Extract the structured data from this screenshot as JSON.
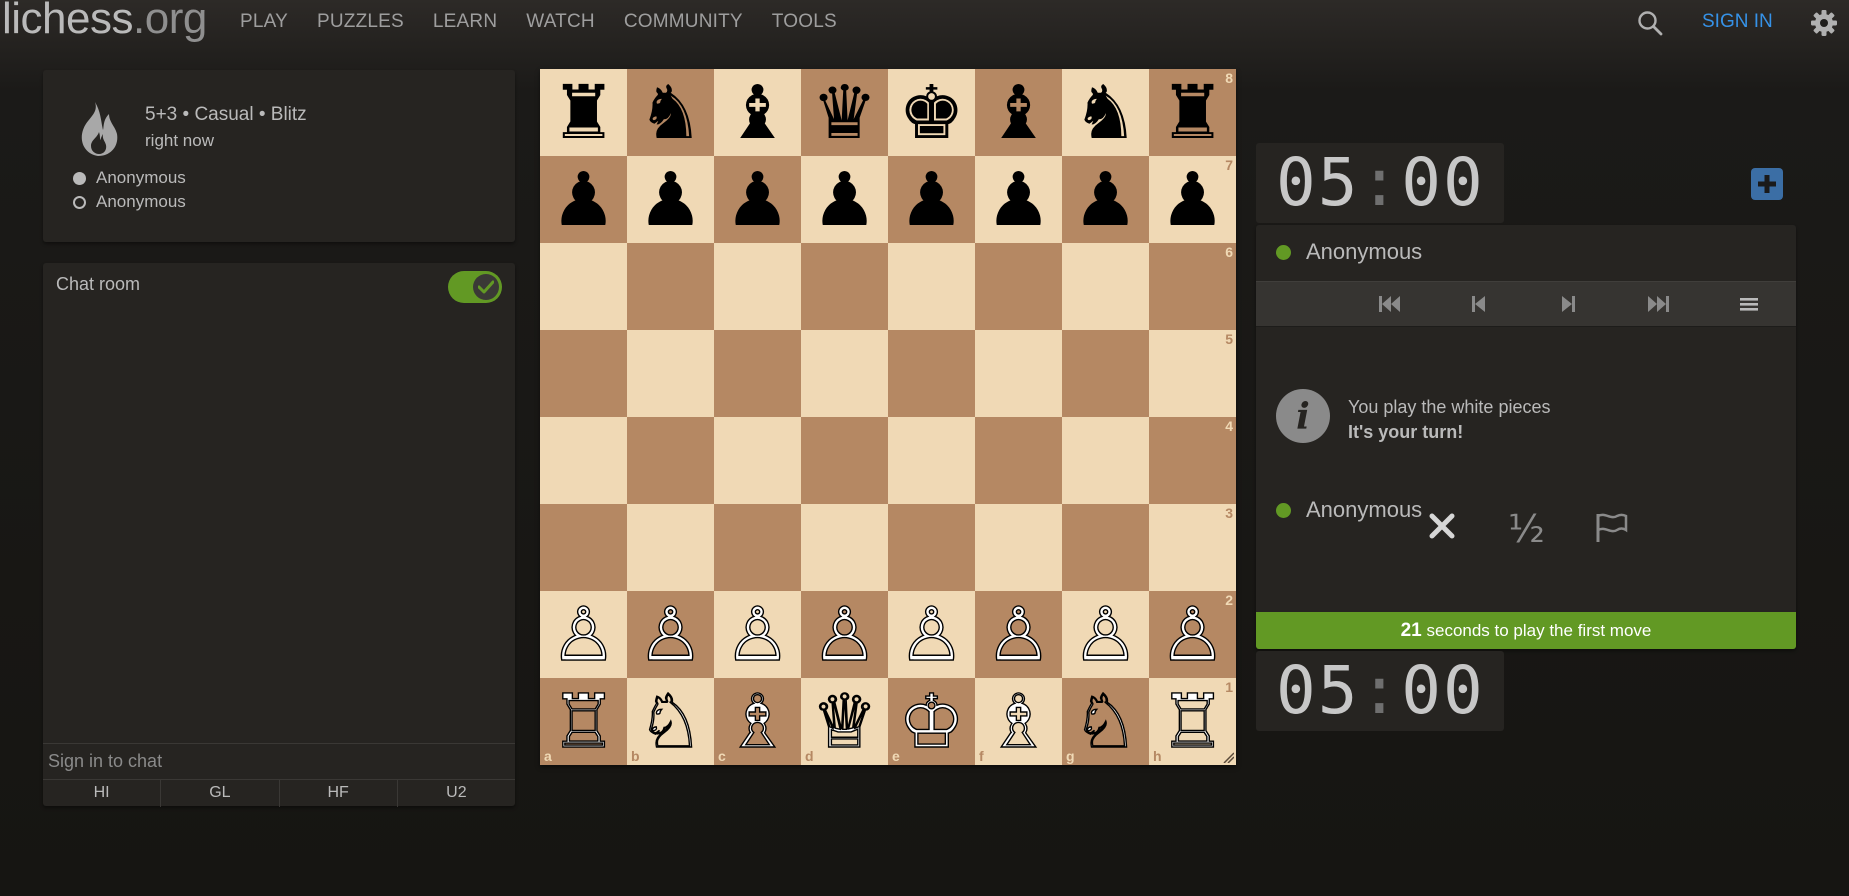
{
  "header": {
    "logo_main": "lichess",
    "logo_tld": ".org",
    "nav": [
      "PLAY",
      "PUZZLES",
      "LEARN",
      "WATCH",
      "COMMUNITY",
      "TOOLS"
    ],
    "sign_in": "SIGN IN"
  },
  "game_info": {
    "title": "5+3 • Casual • Blitz",
    "time_ago": "right now",
    "players": [
      {
        "name": "Anonymous",
        "color": "white"
      },
      {
        "name": "Anonymous",
        "color": "black"
      }
    ]
  },
  "chat": {
    "title": "Chat room",
    "enabled": true,
    "input_placeholder": "Sign in to chat",
    "presets": [
      "HI",
      "GL",
      "HF",
      "U2"
    ]
  },
  "board": {
    "ranks": [
      "8",
      "7",
      "6",
      "5",
      "4",
      "3",
      "2",
      "1"
    ],
    "files": [
      "a",
      "b",
      "c",
      "d",
      "e",
      "f",
      "g",
      "h"
    ],
    "position": [
      [
        "♜",
        "♞",
        "♝",
        "♛",
        "♚",
        "♝",
        "♞",
        "♜"
      ],
      [
        "♟",
        "♟",
        "♟",
        "♟",
        "♟",
        "♟",
        "♟",
        "♟"
      ],
      [
        "",
        "",
        "",
        "",
        "",
        "",
        "",
        ""
      ],
      [
        "",
        "",
        "",
        "",
        "",
        "",
        "",
        ""
      ],
      [
        "",
        "",
        "",
        "",
        "",
        "",
        "",
        ""
      ],
      [
        "",
        "",
        "",
        "",
        "",
        "",
        "",
        ""
      ],
      [
        "♙",
        "♙",
        "♙",
        "♙",
        "♙",
        "♙",
        "♙",
        "♙"
      ],
      [
        "♖",
        "♘",
        "♗",
        "♕",
        "♔",
        "♗",
        "♘",
        "♖"
      ]
    ],
    "colors": {
      "light": "#f0d9b5",
      "dark": "#b58863"
    }
  },
  "clocks": {
    "top": {
      "min": "05",
      "sec": "00"
    },
    "bottom": {
      "min": "05",
      "sec": "00"
    }
  },
  "right_panel": {
    "opponent": "Anonymous",
    "player": "Anonymous",
    "info_line1": "You play the white pieces",
    "info_line2": "It's your turn!",
    "half_label": "½",
    "first_move_seconds": "21",
    "first_move_text": "seconds to play the first move"
  },
  "colors": {
    "accent_green": "#629924",
    "link_blue": "#3692e7",
    "background": "#161512",
    "panel": "#262421"
  }
}
